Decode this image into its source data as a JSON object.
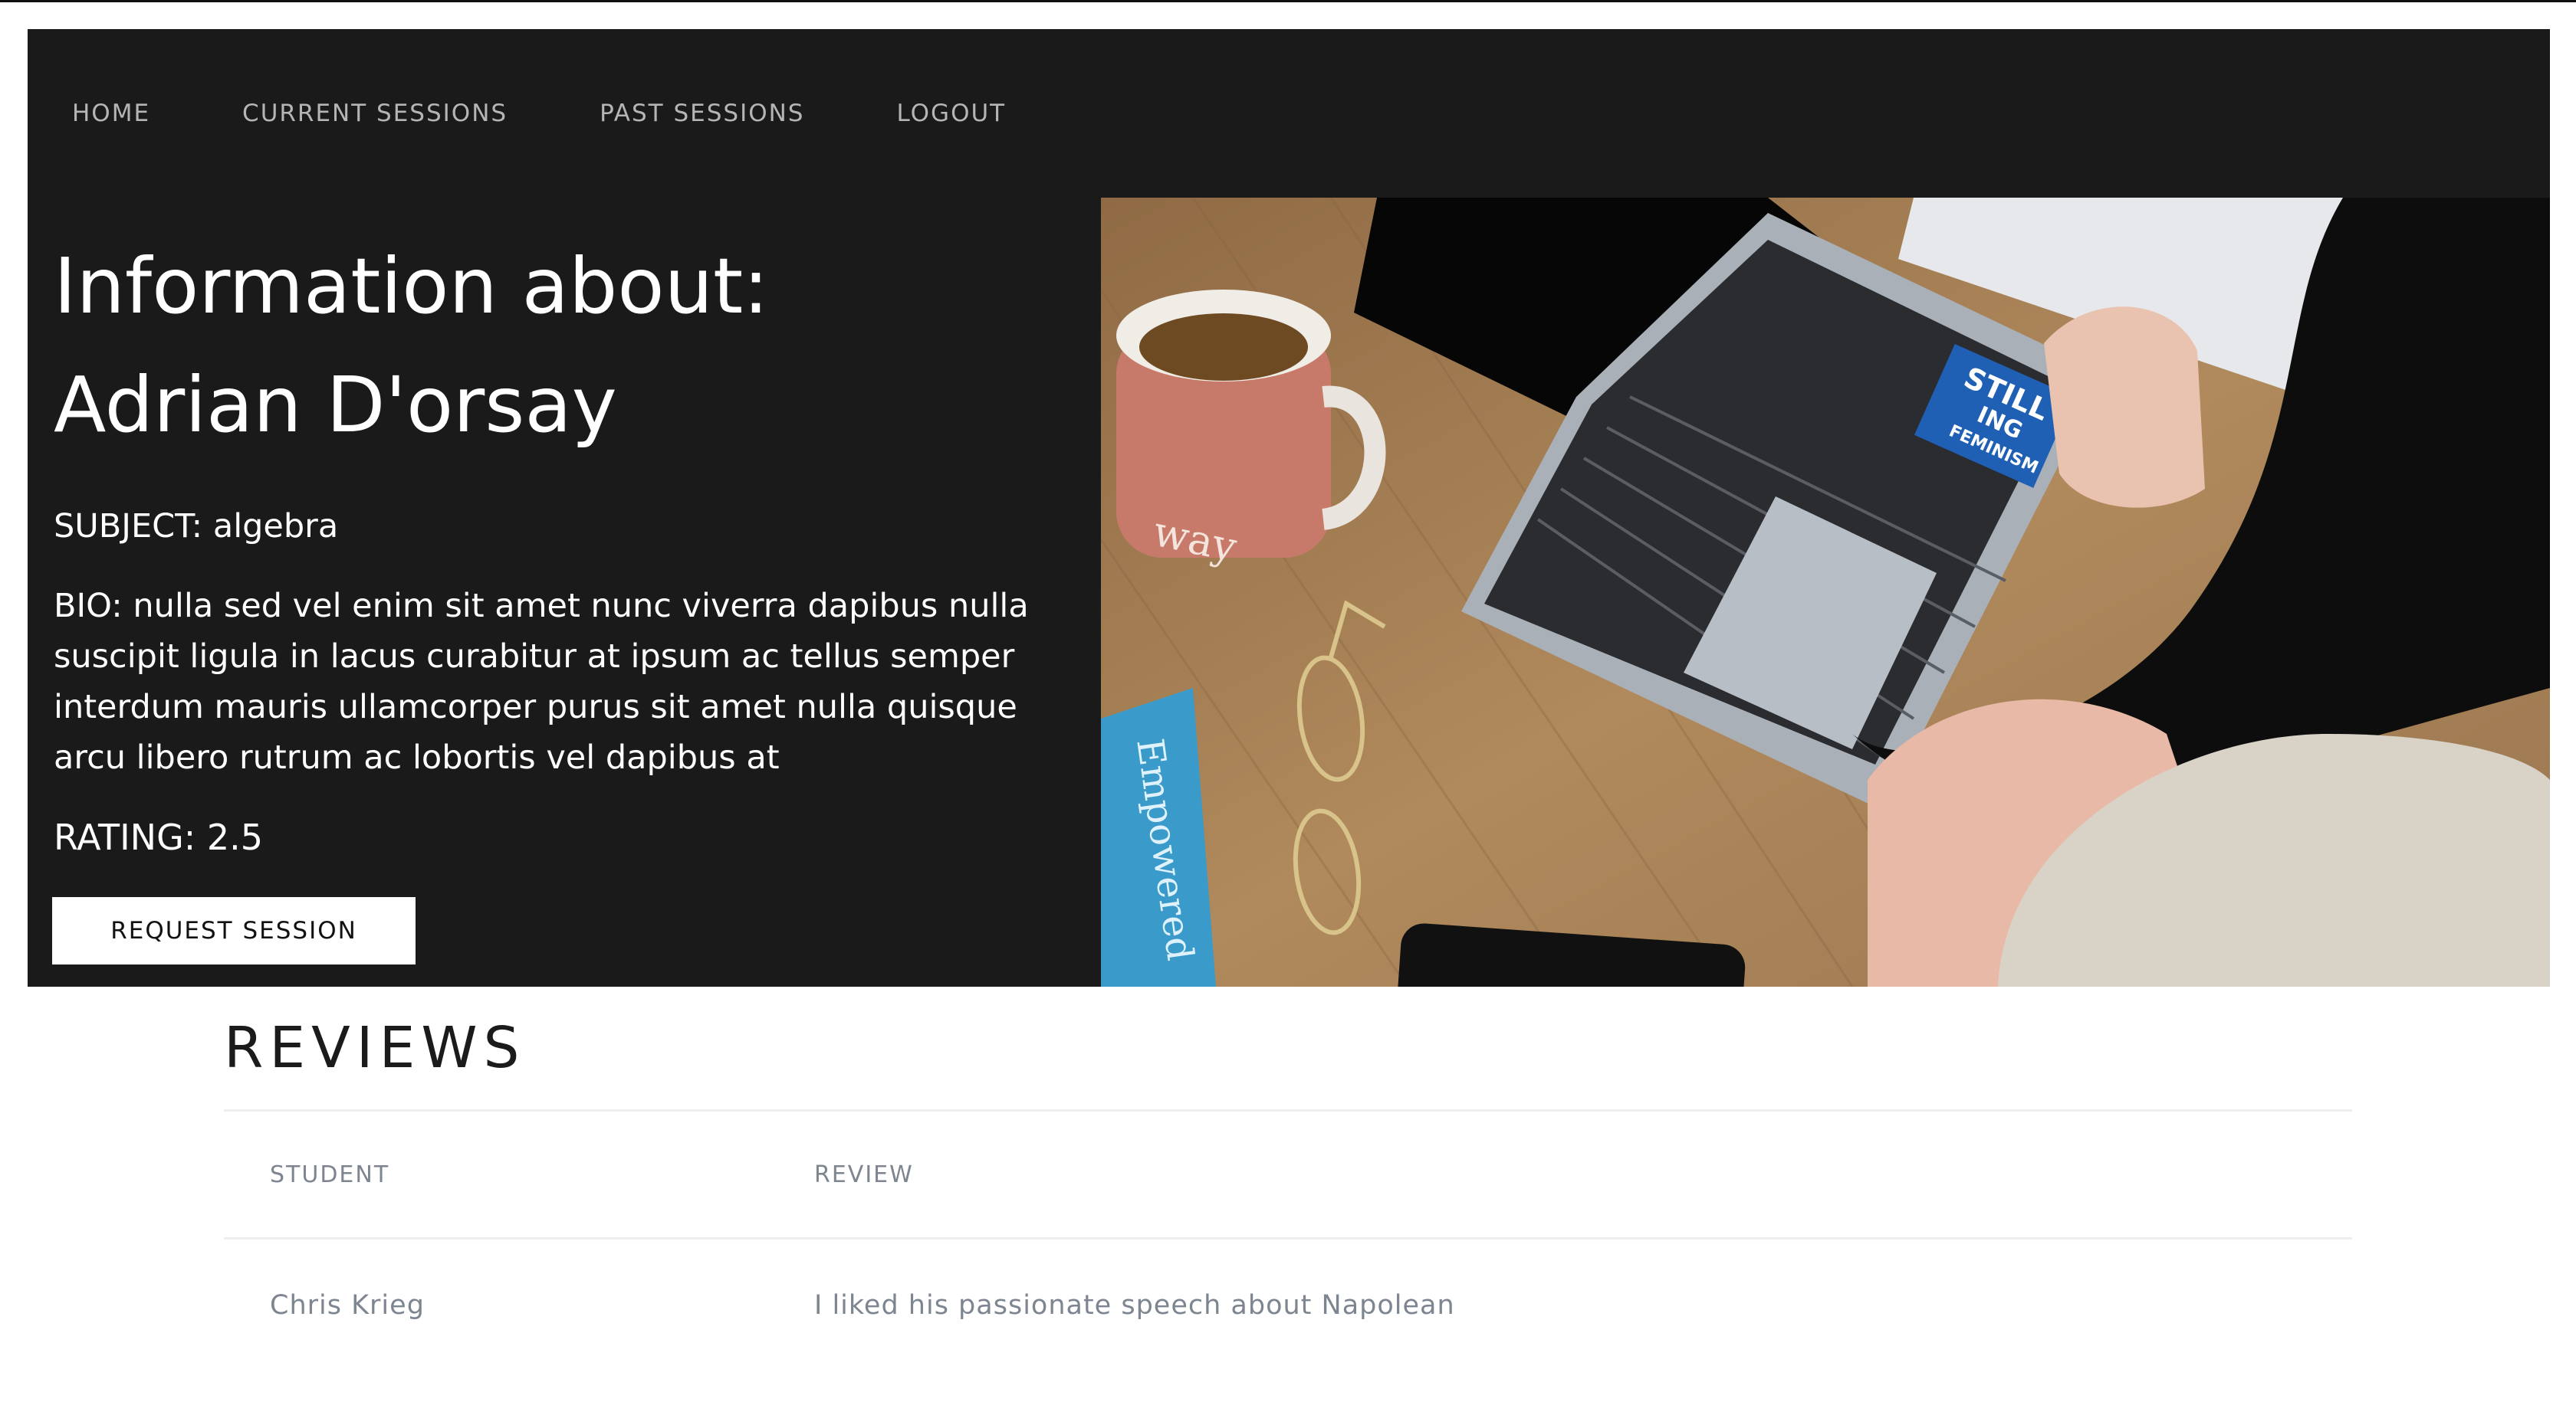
{
  "nav": {
    "items": [
      "HOME",
      "CURRENT SESSIONS",
      "PAST SESSIONS",
      "LOGOUT"
    ]
  },
  "info": {
    "heading_line1": "Information about:",
    "heading_line2": "Adrian D'orsay",
    "subject": "SUBJECT: algebra",
    "bio": "BIO: nulla sed vel enim sit amet nunc viverra dapibus nulla suscipit ligula in lacus curabitur at ipsum ac tellus semper interdum mauris ullamcorper purus sit amet nulla quisque arcu libero rutrum ac lobortis vel dapibus at",
    "rating": "RATING: 2.5",
    "request_button": "REQUEST SESSION"
  },
  "photo": {
    "mug_text": "way",
    "book_text": "Empowered",
    "sticker_line1": "STILL",
    "sticker_line2": "ING",
    "sticker_line3": "FEMINISM"
  },
  "reviews": {
    "title": "REVIEWS",
    "columns": [
      "STUDENT",
      "REVIEW"
    ],
    "rows": [
      {
        "student": "Chris Krieg",
        "review": "I liked his passionate speech about Napolean"
      }
    ]
  },
  "colors": {
    "hero_bg": "#1a1a1a",
    "nav_text": "#b5b5b5",
    "table_text": "#7d8590"
  }
}
